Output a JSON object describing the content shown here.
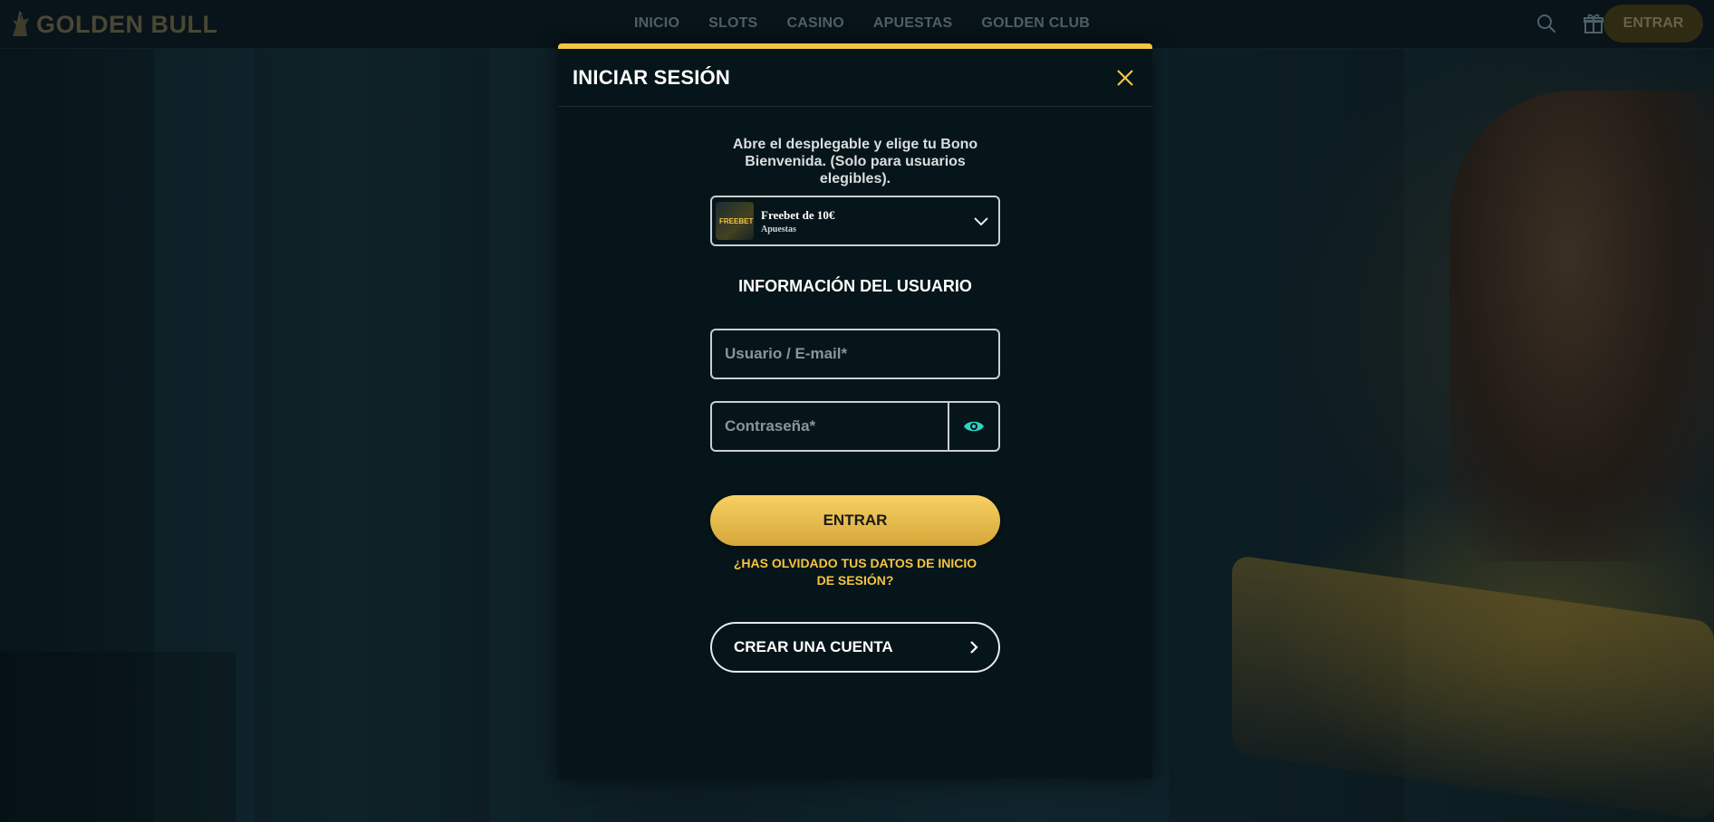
{
  "brand": {
    "name": "GOLDEN BULL"
  },
  "nav": {
    "items": [
      {
        "label": "INICIO"
      },
      {
        "label": "SLOTS"
      },
      {
        "label": "CASINO"
      },
      {
        "label": "APUESTAS"
      },
      {
        "label": "GOLDEN CLUB"
      }
    ],
    "login_label": "ENTRAR",
    "icons": [
      "search-icon",
      "gift-icon"
    ]
  },
  "modal": {
    "title": "INICIAR SESIÓN",
    "bonus_prompt": "Abre el desplegable y elige tu Bono Bienvenida. (Solo para usuarios elegibles).",
    "bonus": {
      "title": "Freebet de 10€",
      "category": "Apuestas",
      "thumb_text": "FREEBET"
    },
    "section_title": "INFORMACIÓN DEL USUARIO",
    "username": {
      "placeholder": "Usuario / E-mail*",
      "value": ""
    },
    "password": {
      "placeholder": "Contraseña*",
      "value": ""
    },
    "submit_label": "ENTRAR",
    "forgot_label": "¿HAS OLVIDADO TUS DATOS DE INICIO DE SESIÓN?",
    "create_label": "CREAR UNA CUENTA"
  },
  "colors": {
    "accent": "#f4c542",
    "eye_icon": "#2fd3c1",
    "background": "#0d1e24",
    "modal_bg": "#061519"
  }
}
